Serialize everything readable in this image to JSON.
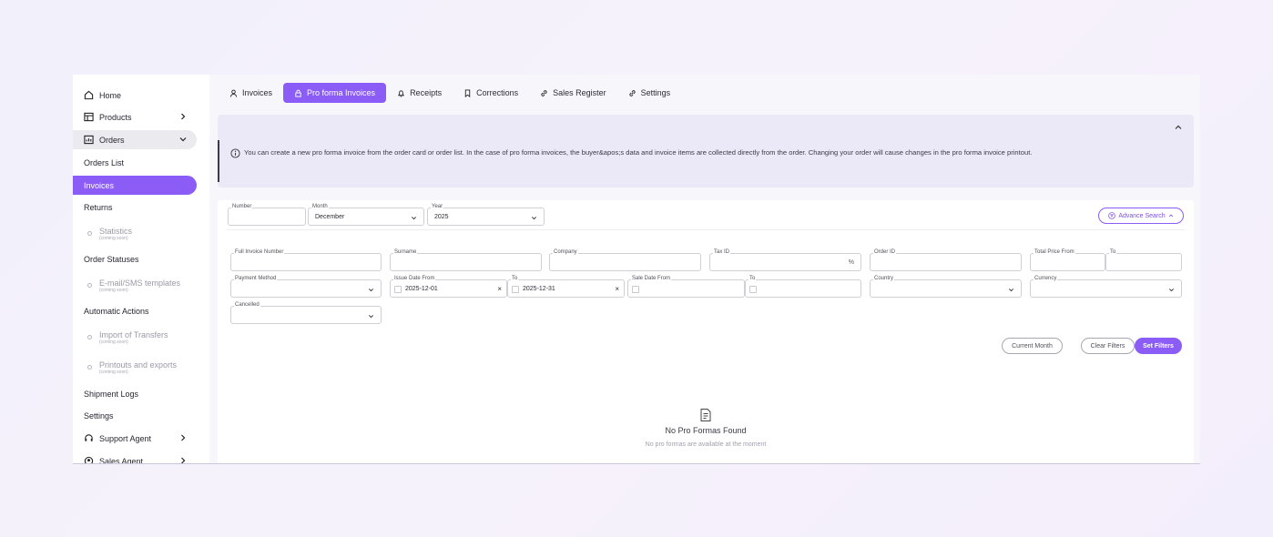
{
  "sidebar": {
    "items": [
      {
        "label": "Home",
        "icon": "home-icon"
      },
      {
        "label": "Products",
        "icon": "products-icon"
      },
      {
        "label": "Orders",
        "icon": "orders-icon"
      },
      {
        "label": "Orders List"
      },
      {
        "label": "Invoices"
      },
      {
        "label": "Returns"
      },
      {
        "label": "Statistics",
        "note": "(coming soon)"
      },
      {
        "label": "Order Statuses"
      },
      {
        "label": "E-mail/SMS templates",
        "note": "(coming soon)"
      },
      {
        "label": "Automatic Actions"
      },
      {
        "label": "Import of Transfers",
        "note": "(coming soon)"
      },
      {
        "label": "Printouts and exports",
        "note": "(coming soon)"
      },
      {
        "label": "Shipment Logs"
      },
      {
        "label": "Settings"
      },
      {
        "label": "Support Agent",
        "icon": "headset-icon"
      },
      {
        "label": "Sales Agent",
        "icon": "agent-icon"
      }
    ]
  },
  "tabs": [
    {
      "label": "Invoices",
      "icon": "user-icon"
    },
    {
      "label": "Pro forma Invoices",
      "icon": "lock-icon"
    },
    {
      "label": "Receipts",
      "icon": "bell-icon"
    },
    {
      "label": "Corrections",
      "icon": "bookmark-icon"
    },
    {
      "label": "Sales Register",
      "icon": "link-icon"
    },
    {
      "label": "Settings",
      "icon": "link-icon"
    }
  ],
  "banner": {
    "text": "You can create a new pro forma invoice from the order card or order list. In the case of pro forma invoices, the buyer&apos;s data and invoice items are collected directly from the order. Changing your order will cause changes in the pro forma invoice printout."
  },
  "filters": {
    "number": {
      "label": "Number",
      "value": ""
    },
    "month": {
      "label": "Month",
      "value": "December"
    },
    "year": {
      "label": "Year",
      "value": "2025"
    },
    "advance_search": "Advance Search",
    "full_invoice_number": {
      "label": "Full Invoice Number",
      "value": ""
    },
    "surname": {
      "label": "Surname",
      "value": ""
    },
    "company": {
      "label": "Company",
      "value": ""
    },
    "tax_id": {
      "label": "Tax ID",
      "suffix": "%"
    },
    "order_id": {
      "label": "Order ID",
      "value": ""
    },
    "total_price_from": {
      "label": "Total Price From",
      "value": ""
    },
    "total_price_to": {
      "label": "To",
      "value": ""
    },
    "payment_method": {
      "label": "Payment Method",
      "value": ""
    },
    "issue_date_from": {
      "label": "Issue Date From",
      "value": "2025-12-01"
    },
    "issue_date_to": {
      "label": "To",
      "value": "2025-12-31"
    },
    "sale_date_from": {
      "label": "Sale Date From",
      "value": ""
    },
    "sale_date_to": {
      "label": "To",
      "value": ""
    },
    "country": {
      "label": "Country",
      "value": ""
    },
    "currency": {
      "label": "Currency",
      "value": ""
    },
    "cancelled": {
      "label": "Cancelled",
      "value": ""
    },
    "clear_mark": "×"
  },
  "actions": {
    "current_month": "Current Month",
    "clear_filters": "Clear Filters",
    "set_filters": "Set Filters"
  },
  "empty": {
    "title": "No Pro Formas Found",
    "subtitle": "No pro formas are available at the moment"
  },
  "colors": {
    "accent": "#8b5cf6",
    "banner_bg": "#ebe8f7"
  }
}
